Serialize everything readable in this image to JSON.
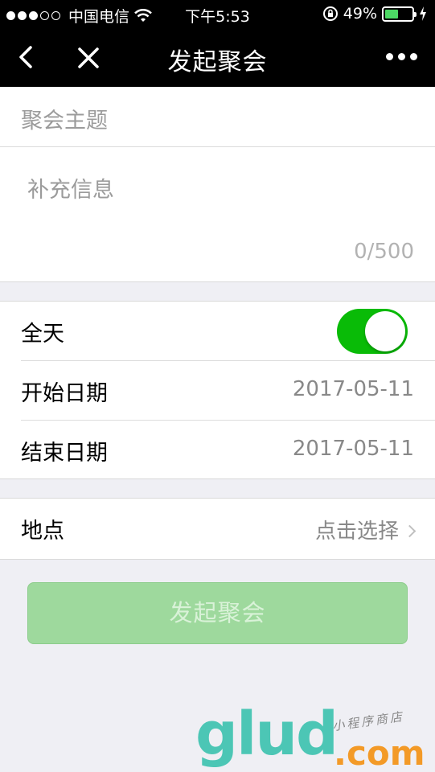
{
  "status_bar": {
    "carrier": "中国电信",
    "time": "下午5:53",
    "battery_percent": "49%",
    "battery_level": 0.49,
    "signal_icons": [
      "signal-dots-icon",
      "wifi-icon"
    ],
    "right_icons": [
      "rotation-lock-icon",
      "battery-icon",
      "charging-icon"
    ]
  },
  "nav": {
    "title": "发起聚会",
    "back_icon": "chevron-left-icon",
    "close_icon": "close-icon",
    "more_icon": "more-icon"
  },
  "form": {
    "topic_placeholder": "聚会主题",
    "info_placeholder": "补充信息",
    "char_counter": "0/500",
    "all_day_label": "全天",
    "all_day_on": true,
    "start_date_label": "开始日期",
    "start_date_value": "2017-05-11",
    "end_date_label": "结束日期",
    "end_date_value": "2017-05-11",
    "location_label": "地点",
    "location_value": "点击选择",
    "submit_label": "发起聚会"
  },
  "colors": {
    "accent_green": "#09bb07",
    "button_disabled_green": "#9ed99d",
    "watermark_teal": "#4cc6b5",
    "watermark_orange": "#f39a27"
  },
  "watermark": {
    "brand": "glud",
    "suffix": ".com",
    "tagline": "小程序商店"
  }
}
